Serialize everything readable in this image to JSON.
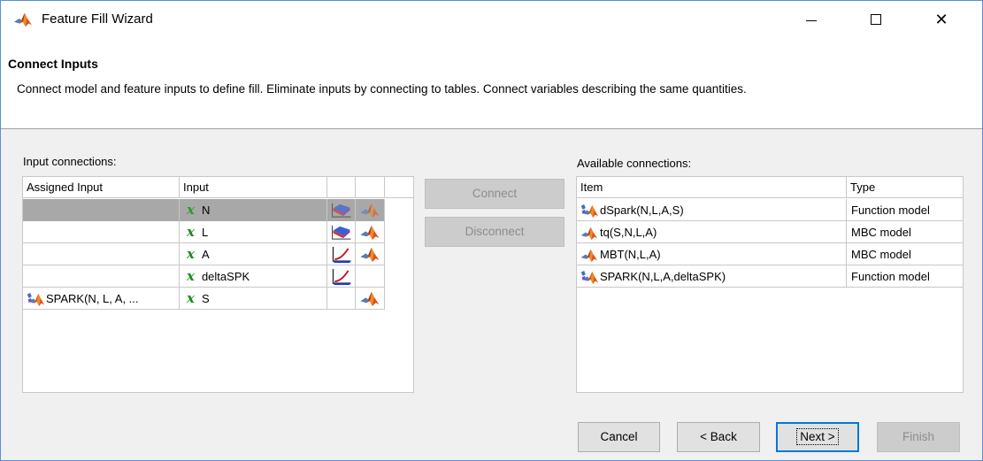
{
  "window": {
    "title": "Feature Fill Wizard",
    "minimize": "—",
    "maximize": "☐",
    "close": "✕"
  },
  "header": {
    "title": "Connect Inputs",
    "description": "Connect model and feature inputs to define fill. Eliminate inputs by connecting to tables. Connect variables describing the same quantities."
  },
  "left": {
    "label": "Input connections:",
    "columns": [
      "Assigned Input",
      "Input"
    ],
    "rows": [
      {
        "assigned": "",
        "var": "x",
        "input": "N"
      },
      {
        "assigned": "",
        "var": "x",
        "input": "L"
      },
      {
        "assigned": "",
        "var": "x",
        "input": "A"
      },
      {
        "assigned": "",
        "var": "x",
        "input": "deltaSPK"
      },
      {
        "assigned": "SPARK(N, L, A, ...",
        "var": "x",
        "input": "S"
      }
    ]
  },
  "middle": {
    "connect": "Connect",
    "disconnect": "Disconnect"
  },
  "right": {
    "label": "Available connections:",
    "columns": [
      "Item",
      "Type"
    ],
    "rows": [
      {
        "item": "dSpark(N,L,A,S)",
        "type": "Function model"
      },
      {
        "item": "tq(S,N,L,A)",
        "type": "MBC model"
      },
      {
        "item": "MBT(N,L,A)",
        "type": "MBC model"
      },
      {
        "item": "SPARK(N,L,A,deltaSPK)",
        "type": "Function model"
      }
    ]
  },
  "footer": {
    "cancel": "Cancel",
    "back": "< Back",
    "next": "Next >",
    "finish": "Finish"
  },
  "colors": {
    "selected_row": "#a8a8a8",
    "variable_green": "#1a8a1a",
    "matlab_orange": "#e0601a",
    "default_button_border": "#0078d7"
  }
}
